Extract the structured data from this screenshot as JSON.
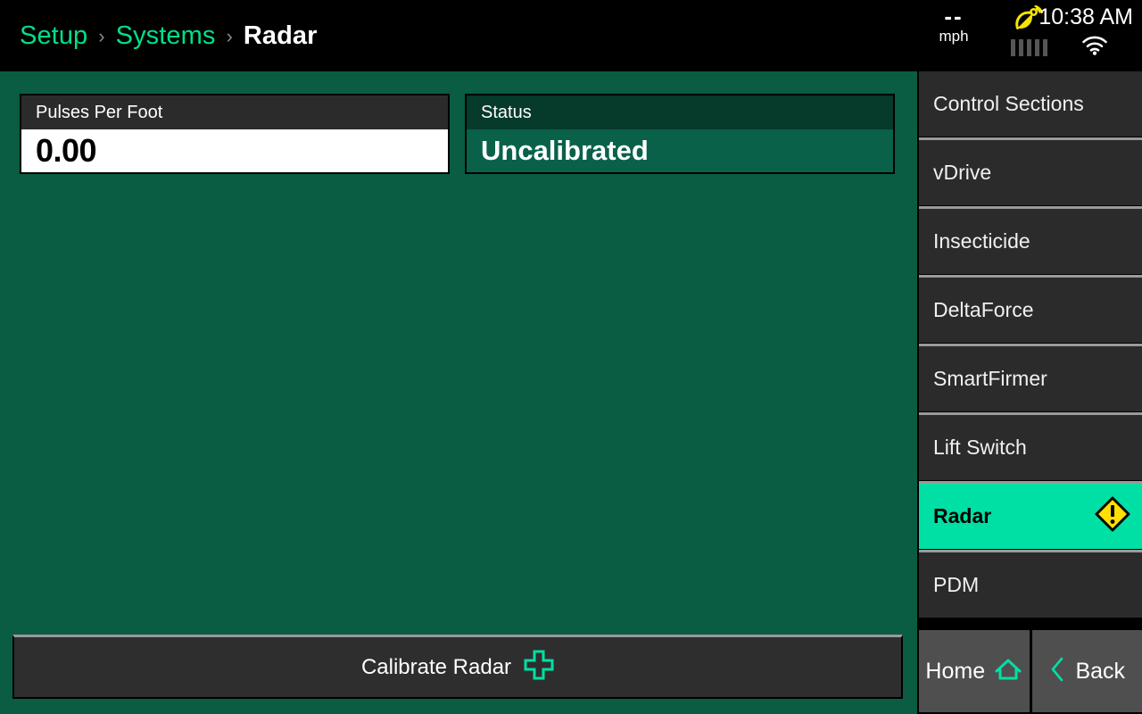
{
  "breadcrumb": {
    "items": [
      {
        "label": "Setup",
        "current": false
      },
      {
        "label": "Systems",
        "current": false
      },
      {
        "label": "Radar",
        "current": true
      }
    ],
    "separator": "›"
  },
  "statusbar": {
    "speed_value": "--",
    "speed_unit": "mph",
    "gps_icon": "satellite-dish-icon",
    "gps_bars": 5,
    "time": "10:38 AM",
    "wifi_icon": "wifi-icon"
  },
  "cards": [
    {
      "title": "Pulses Per Foot",
      "value": "0.00",
      "style": "dark"
    },
    {
      "title": "Status",
      "value": "Uncalibrated",
      "style": "green"
    }
  ],
  "calibrate": {
    "label": "Calibrate Radar",
    "icon": "plus-cross-icon"
  },
  "sidebar": {
    "items": [
      {
        "label": "Control Sections",
        "selected": false,
        "warning": false
      },
      {
        "label": "vDrive",
        "selected": false,
        "warning": false
      },
      {
        "label": "Insecticide",
        "selected": false,
        "warning": false
      },
      {
        "label": "DeltaForce",
        "selected": false,
        "warning": false
      },
      {
        "label": "SmartFirmer",
        "selected": false,
        "warning": false
      },
      {
        "label": "Lift Switch",
        "selected": false,
        "warning": false
      },
      {
        "label": "Radar",
        "selected": true,
        "warning": true
      },
      {
        "label": "PDM",
        "selected": false,
        "warning": false
      }
    ]
  },
  "bottomnav": {
    "home_label": "Home",
    "home_icon": "home-icon",
    "back_label": "Back",
    "back_icon": "chevron-left-icon"
  },
  "colors": {
    "accent_green": "#00e089",
    "selected_teal": "#00e0a4",
    "background_green": "#0a5c42",
    "status_body_green": "#09614a",
    "status_head_green": "#063a2a",
    "panel_dark": "#2b2b2b",
    "warning_yellow": "#ffe000",
    "gps_yellow": "#f5e400"
  }
}
